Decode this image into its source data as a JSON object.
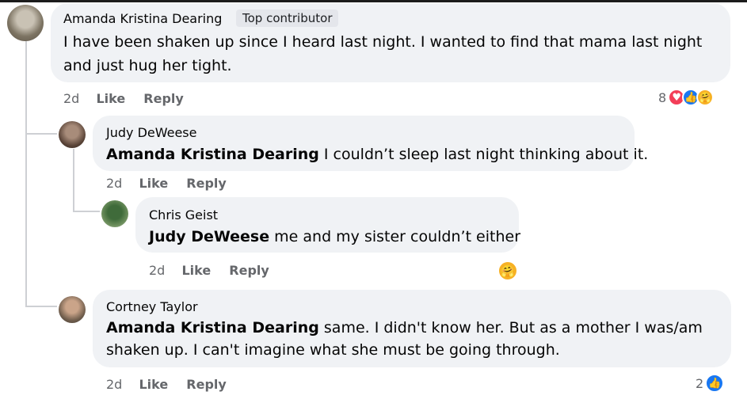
{
  "comments": [
    {
      "author": "Amanda Kristina Dearing",
      "badge": "Top contributor",
      "text": "I have been shaken up since I heard last night. I wanted to find that mama last night and just hug her tight.",
      "line1": "I have been shaken up since I heard last night. I wanted to find that mama last night",
      "line2": "and just hug her tight.",
      "time": "2d",
      "like": "Like",
      "reply": "Reply",
      "reaction_count": "8",
      "reactions": [
        "love-icon",
        "like-icon",
        "care-icon"
      ]
    },
    {
      "author": "Judy DeWeese",
      "mention": "Amanda Kristina Dearing",
      "text": "I couldn’t sleep last night thinking about it.",
      "time": "2d",
      "like": "Like",
      "reply": "Reply"
    },
    {
      "author": "Chris Geist",
      "mention": "Judy DeWeese",
      "text": "me and my sister couldn’t either",
      "time": "2d",
      "like": "Like",
      "reply": "Reply",
      "reactions": [
        "care-icon"
      ]
    },
    {
      "author": "Cortney Taylor",
      "mention": "Amanda Kristina Dearing",
      "line1": "same. I didn't know her. But as a mother I was/am",
      "line2": "shaken up. I can't imagine what she must be going through.",
      "time": "2d",
      "like": "Like",
      "reply": "Reply",
      "reaction_count": "2",
      "reactions": [
        "like-icon"
      ]
    }
  ],
  "colors": {
    "bubble": "#f0f2f5",
    "meta": "#65676b",
    "like_blue": "#1877f2",
    "love_red": "#f33e58",
    "care_yellow": "#f7b125"
  }
}
